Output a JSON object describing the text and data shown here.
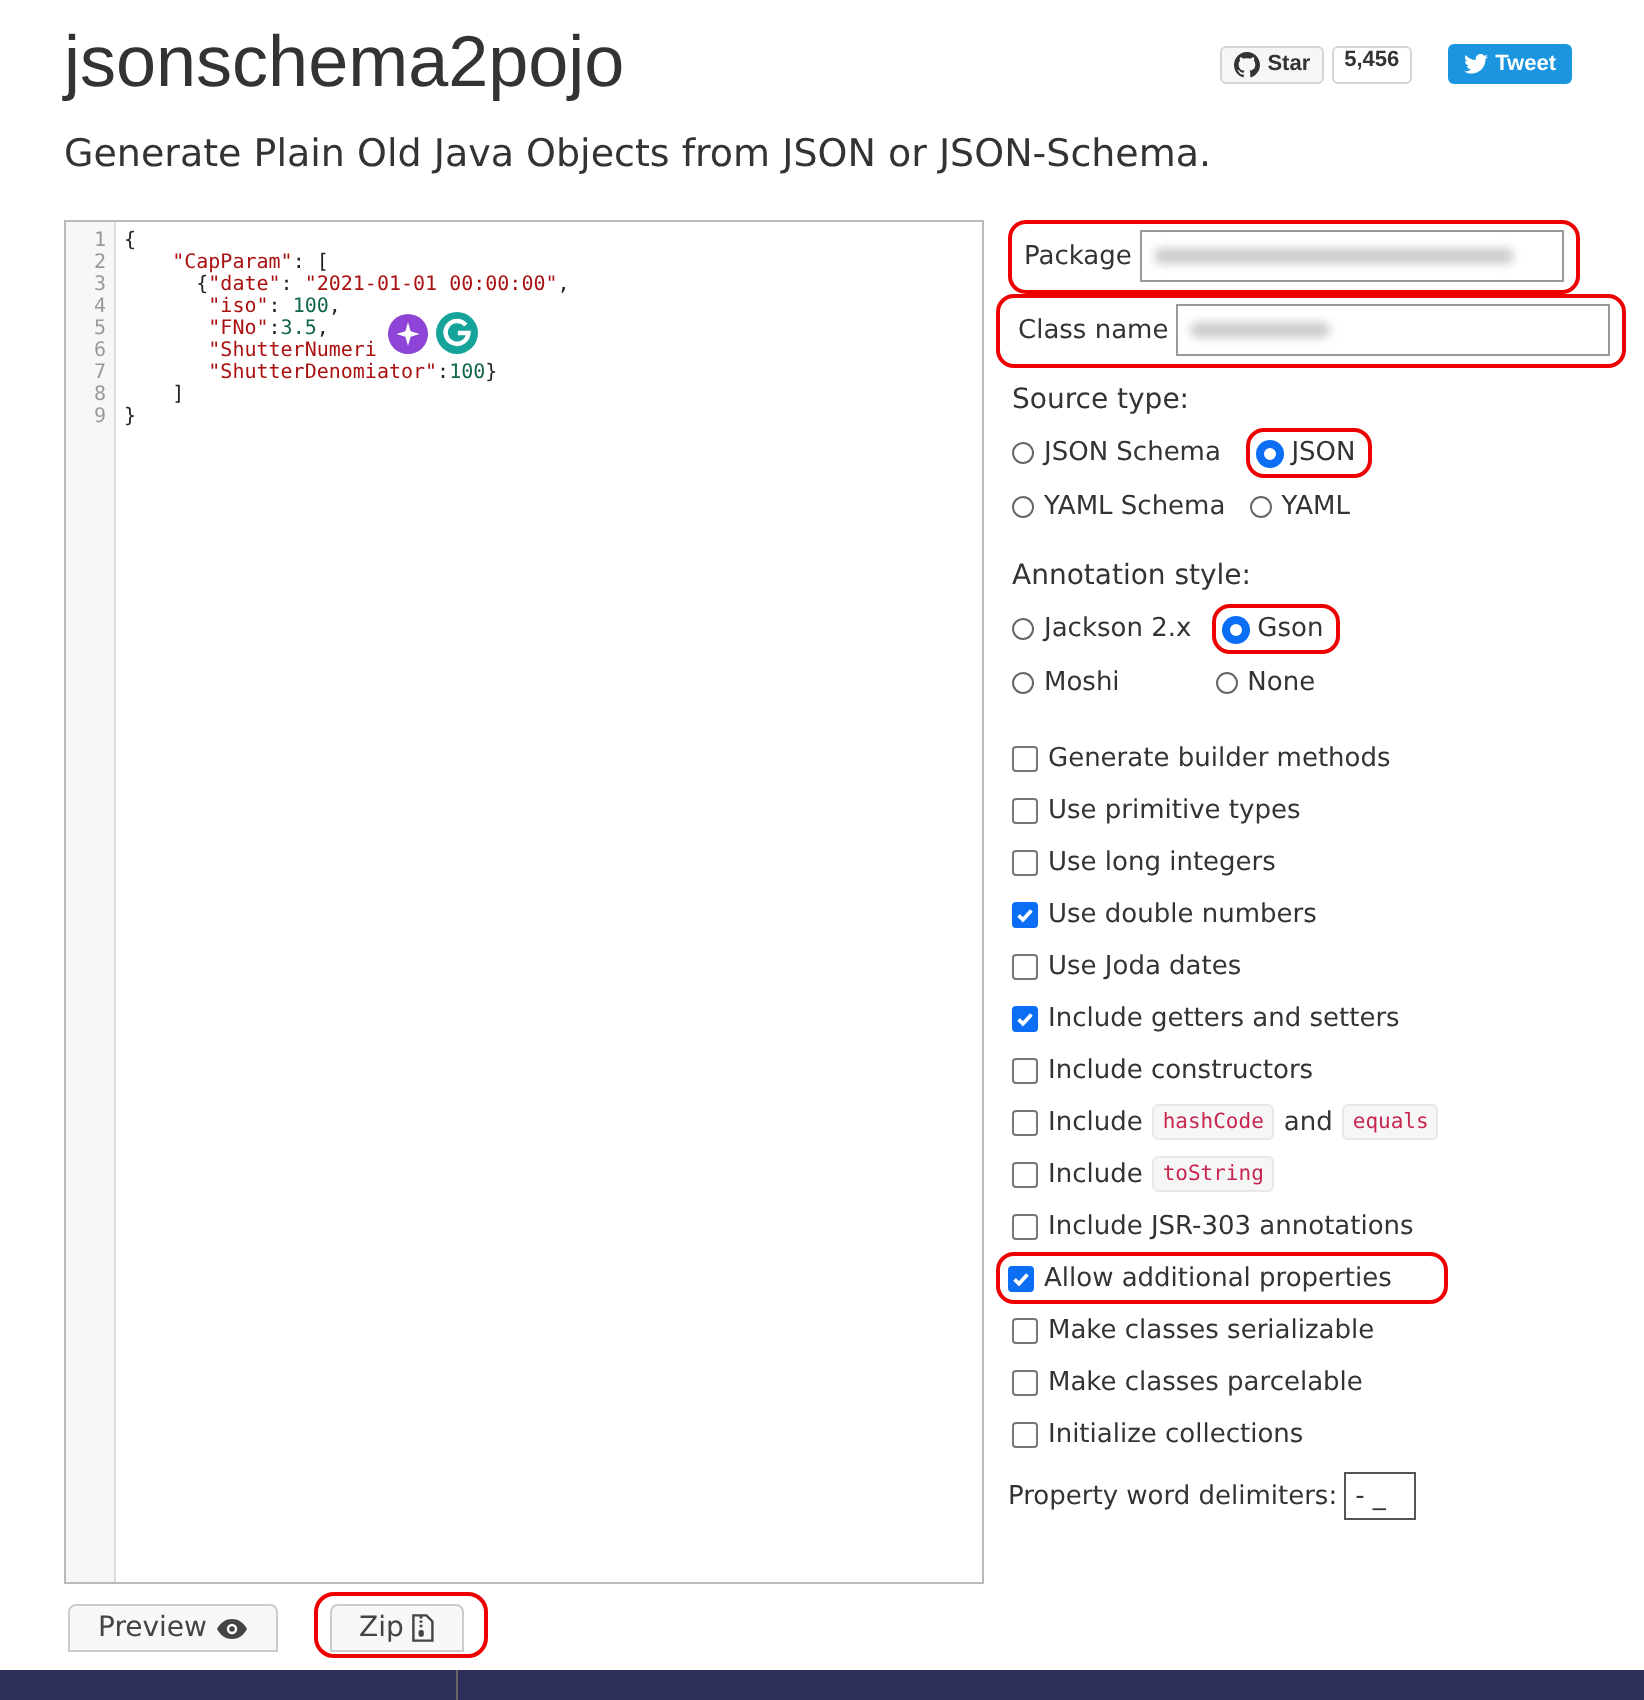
{
  "title": "jsonschema2pojo",
  "social": {
    "star_label": "Star",
    "star_count": "5,456",
    "tweet_label": "Tweet"
  },
  "subtitle": "Generate Plain Old Java Objects from JSON or JSON-Schema.",
  "editor": {
    "line_numbers": [
      "1",
      "2",
      "3",
      "4",
      "5",
      "6",
      "7",
      "8",
      "9"
    ],
    "lines": [
      "{",
      "    \"CapParam\": [",
      "      {\"date\": \"2021-01-01 00:00:00\",",
      "       \"iso\": 100,",
      "       \"FNo\":3.5,",
      "       \"ShutterNumeri",
      "       \"ShutterDenomiator\":100}",
      "    ]",
      "}"
    ]
  },
  "package": {
    "label": "Package",
    "highlighted": true
  },
  "class_name": {
    "label": "Class name",
    "highlighted": true
  },
  "source_type": {
    "label": "Source type:",
    "options": [
      {
        "label": "JSON Schema",
        "selected": false,
        "highlighted": false
      },
      {
        "label": "JSON",
        "selected": true,
        "highlighted": true
      },
      {
        "label": "YAML Schema",
        "selected": false,
        "highlighted": false
      },
      {
        "label": "YAML",
        "selected": false,
        "highlighted": false
      }
    ]
  },
  "annotation_style": {
    "label": "Annotation style:",
    "options": [
      {
        "label": "Jackson 2.x",
        "selected": false,
        "highlighted": false
      },
      {
        "label": "Gson",
        "selected": true,
        "highlighted": true
      },
      {
        "label": "Moshi",
        "selected": false,
        "highlighted": false
      },
      {
        "label": "None",
        "selected": false,
        "highlighted": false
      }
    ]
  },
  "checkboxes": [
    {
      "parts": [
        {
          "text": "Generate builder methods",
          "kind": "text"
        }
      ],
      "checked": false,
      "highlighted": false
    },
    {
      "parts": [
        {
          "text": "Use primitive types",
          "kind": "text"
        }
      ],
      "checked": false,
      "highlighted": false
    },
    {
      "parts": [
        {
          "text": "Use long integers",
          "kind": "text"
        }
      ],
      "checked": false,
      "highlighted": false
    },
    {
      "parts": [
        {
          "text": "Use double numbers",
          "kind": "text"
        }
      ],
      "checked": true,
      "highlighted": false
    },
    {
      "parts": [
        {
          "text": "Use Joda dates",
          "kind": "text"
        }
      ],
      "checked": false,
      "highlighted": false
    },
    {
      "parts": [
        {
          "text": "Include getters and setters",
          "kind": "text"
        }
      ],
      "checked": true,
      "highlighted": false
    },
    {
      "parts": [
        {
          "text": "Include constructors",
          "kind": "text"
        }
      ],
      "checked": false,
      "highlighted": false
    },
    {
      "parts": [
        {
          "text": "Include",
          "kind": "text"
        },
        {
          "text": "hashCode",
          "kind": "code"
        },
        {
          "text": "and",
          "kind": "text"
        },
        {
          "text": "equals",
          "kind": "code"
        }
      ],
      "checked": false,
      "highlighted": false
    },
    {
      "parts": [
        {
          "text": "Include",
          "kind": "text"
        },
        {
          "text": "toString",
          "kind": "code"
        }
      ],
      "checked": false,
      "highlighted": false
    },
    {
      "parts": [
        {
          "text": "Include JSR-303 annotations",
          "kind": "text"
        }
      ],
      "checked": false,
      "highlighted": false
    },
    {
      "parts": [
        {
          "text": "Allow additional properties",
          "kind": "text"
        }
      ],
      "checked": true,
      "highlighted": true
    },
    {
      "parts": [
        {
          "text": "Make classes serializable",
          "kind": "text"
        }
      ],
      "checked": false,
      "highlighted": false
    },
    {
      "parts": [
        {
          "text": "Make classes parcelable",
          "kind": "text"
        }
      ],
      "checked": false,
      "highlighted": false
    },
    {
      "parts": [
        {
          "text": "Initialize collections",
          "kind": "text"
        }
      ],
      "checked": false,
      "highlighted": false
    }
  ],
  "delimiters": {
    "label": "Property word delimiters:",
    "value": "- _"
  },
  "buttons": [
    {
      "label": "Preview",
      "kind": "preview",
      "highlighted": false
    },
    {
      "label": "Zip",
      "kind": "zip",
      "highlighted": true
    }
  ]
}
